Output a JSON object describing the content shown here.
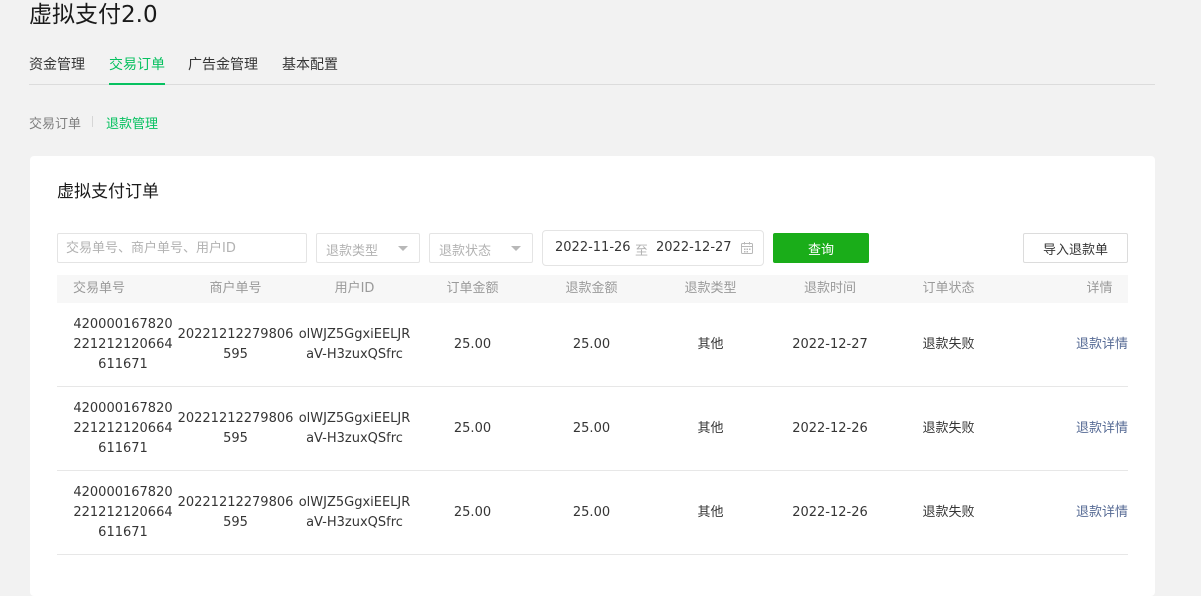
{
  "app": {
    "title": "虚拟支付2.0"
  },
  "main_tabs": [
    {
      "label": "资金管理"
    },
    {
      "label": "交易订单"
    },
    {
      "label": "广告金管理"
    },
    {
      "label": "基本配置"
    }
  ],
  "active_main_tab": "交易订单",
  "sub_tabs": [
    {
      "label": "交易订单"
    },
    {
      "label": "退款管理"
    }
  ],
  "active_sub_tab": "退款管理",
  "card": {
    "title": "虚拟支付订单"
  },
  "filters": {
    "search_placeholder": "交易单号、商户单号、用户ID",
    "refund_type_placeholder": "退款类型",
    "refund_status_placeholder": "退款状态",
    "date_start": "2022-11-26",
    "date_separator": "至",
    "date_end": "2022-12-27",
    "query_label": "查询",
    "import_label": "导入退款单"
  },
  "table": {
    "columns": [
      "交易单号",
      "商户单号",
      "用户ID",
      "订单金额",
      "退款金额",
      "退款类型",
      "退款时间",
      "订单状态",
      "详情"
    ],
    "rows": [
      {
        "transaction_no": "420000167820221212120664611671",
        "merchant_no": "20221212279806595",
        "user_id": "olWJZ5GgxiEELJRaV-H3zuxQSfrc",
        "order_amount": "25.00",
        "refund_amount": "25.00",
        "refund_type": "其他",
        "refund_time": "2022-12-27",
        "order_status": "退款失败",
        "detail_link": "退款详情"
      },
      {
        "transaction_no": "420000167820221212120664611671",
        "merchant_no": "20221212279806595",
        "user_id": "olWJZ5GgxiEELJRaV-H3zuxQSfrc",
        "order_amount": "25.00",
        "refund_amount": "25.00",
        "refund_type": "其他",
        "refund_time": "2022-12-26",
        "order_status": "退款失败",
        "detail_link": "退款详情"
      },
      {
        "transaction_no": "420000167820221212120664611671",
        "merchant_no": "20221212279806595",
        "user_id": "olWJZ5GgxiEELJRaV-H3zuxQSfrc",
        "order_amount": "25.00",
        "refund_amount": "25.00",
        "refund_type": "其他",
        "refund_time": "2022-12-26",
        "order_status": "退款失败",
        "detail_link": "退款详情"
      }
    ]
  },
  "colors": {
    "accent": "#07c160",
    "primary_button": "#1aad19",
    "link": "#576b95"
  }
}
